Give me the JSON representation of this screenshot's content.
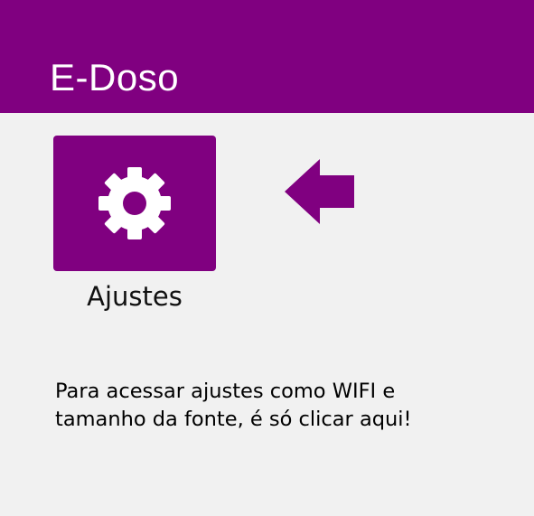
{
  "app": {
    "title": "E-Doso"
  },
  "tile": {
    "label": "Ajustes",
    "icon": "gear-icon"
  },
  "pointer": {
    "icon": "arrow-left-icon"
  },
  "hint": {
    "text": "Para acessar ajustes como WIFI e tamanho da fonte, é só clicar aqui!"
  },
  "colors": {
    "primary": "#800080",
    "background": "#f1f1f1",
    "text": "#000000",
    "on_primary": "#ffffff"
  }
}
